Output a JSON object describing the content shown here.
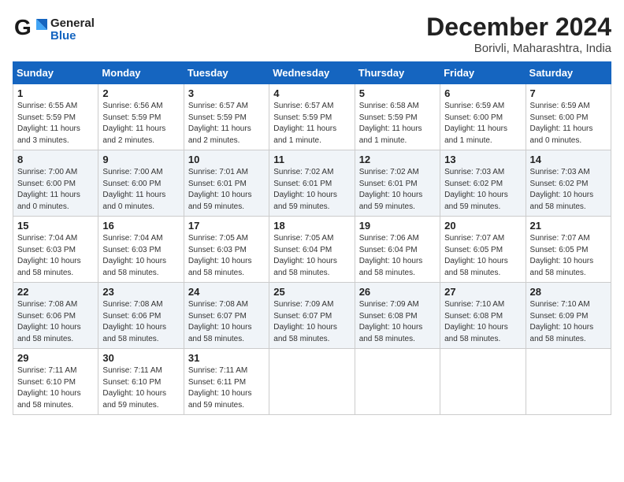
{
  "logo": {
    "general": "General",
    "blue": "Blue"
  },
  "title": {
    "month": "December 2024",
    "location": "Borivli, Maharashtra, India"
  },
  "headers": [
    "Sunday",
    "Monday",
    "Tuesday",
    "Wednesday",
    "Thursday",
    "Friday",
    "Saturday"
  ],
  "weeks": [
    [
      {
        "day": "1",
        "info": "Sunrise: 6:55 AM\nSunset: 5:59 PM\nDaylight: 11 hours and 3 minutes."
      },
      {
        "day": "2",
        "info": "Sunrise: 6:56 AM\nSunset: 5:59 PM\nDaylight: 11 hours and 2 minutes."
      },
      {
        "day": "3",
        "info": "Sunrise: 6:57 AM\nSunset: 5:59 PM\nDaylight: 11 hours and 2 minutes."
      },
      {
        "day": "4",
        "info": "Sunrise: 6:57 AM\nSunset: 5:59 PM\nDaylight: 11 hours and 1 minute."
      },
      {
        "day": "5",
        "info": "Sunrise: 6:58 AM\nSunset: 5:59 PM\nDaylight: 11 hours and 1 minute."
      },
      {
        "day": "6",
        "info": "Sunrise: 6:59 AM\nSunset: 6:00 PM\nDaylight: 11 hours and 1 minute."
      },
      {
        "day": "7",
        "info": "Sunrise: 6:59 AM\nSunset: 6:00 PM\nDaylight: 11 hours and 0 minutes."
      }
    ],
    [
      {
        "day": "8",
        "info": "Sunrise: 7:00 AM\nSunset: 6:00 PM\nDaylight: 11 hours and 0 minutes."
      },
      {
        "day": "9",
        "info": "Sunrise: 7:00 AM\nSunset: 6:00 PM\nDaylight: 11 hours and 0 minutes."
      },
      {
        "day": "10",
        "info": "Sunrise: 7:01 AM\nSunset: 6:01 PM\nDaylight: 10 hours and 59 minutes."
      },
      {
        "day": "11",
        "info": "Sunrise: 7:02 AM\nSunset: 6:01 PM\nDaylight: 10 hours and 59 minutes."
      },
      {
        "day": "12",
        "info": "Sunrise: 7:02 AM\nSunset: 6:01 PM\nDaylight: 10 hours and 59 minutes."
      },
      {
        "day": "13",
        "info": "Sunrise: 7:03 AM\nSunset: 6:02 PM\nDaylight: 10 hours and 59 minutes."
      },
      {
        "day": "14",
        "info": "Sunrise: 7:03 AM\nSunset: 6:02 PM\nDaylight: 10 hours and 58 minutes."
      }
    ],
    [
      {
        "day": "15",
        "info": "Sunrise: 7:04 AM\nSunset: 6:03 PM\nDaylight: 10 hours and 58 minutes."
      },
      {
        "day": "16",
        "info": "Sunrise: 7:04 AM\nSunset: 6:03 PM\nDaylight: 10 hours and 58 minutes."
      },
      {
        "day": "17",
        "info": "Sunrise: 7:05 AM\nSunset: 6:03 PM\nDaylight: 10 hours and 58 minutes."
      },
      {
        "day": "18",
        "info": "Sunrise: 7:05 AM\nSunset: 6:04 PM\nDaylight: 10 hours and 58 minutes."
      },
      {
        "day": "19",
        "info": "Sunrise: 7:06 AM\nSunset: 6:04 PM\nDaylight: 10 hours and 58 minutes."
      },
      {
        "day": "20",
        "info": "Sunrise: 7:07 AM\nSunset: 6:05 PM\nDaylight: 10 hours and 58 minutes."
      },
      {
        "day": "21",
        "info": "Sunrise: 7:07 AM\nSunset: 6:05 PM\nDaylight: 10 hours and 58 minutes."
      }
    ],
    [
      {
        "day": "22",
        "info": "Sunrise: 7:08 AM\nSunset: 6:06 PM\nDaylight: 10 hours and 58 minutes."
      },
      {
        "day": "23",
        "info": "Sunrise: 7:08 AM\nSunset: 6:06 PM\nDaylight: 10 hours and 58 minutes."
      },
      {
        "day": "24",
        "info": "Sunrise: 7:08 AM\nSunset: 6:07 PM\nDaylight: 10 hours and 58 minutes."
      },
      {
        "day": "25",
        "info": "Sunrise: 7:09 AM\nSunset: 6:07 PM\nDaylight: 10 hours and 58 minutes."
      },
      {
        "day": "26",
        "info": "Sunrise: 7:09 AM\nSunset: 6:08 PM\nDaylight: 10 hours and 58 minutes."
      },
      {
        "day": "27",
        "info": "Sunrise: 7:10 AM\nSunset: 6:08 PM\nDaylight: 10 hours and 58 minutes."
      },
      {
        "day": "28",
        "info": "Sunrise: 7:10 AM\nSunset: 6:09 PM\nDaylight: 10 hours and 58 minutes."
      }
    ],
    [
      {
        "day": "29",
        "info": "Sunrise: 7:11 AM\nSunset: 6:10 PM\nDaylight: 10 hours and 58 minutes."
      },
      {
        "day": "30",
        "info": "Sunrise: 7:11 AM\nSunset: 6:10 PM\nDaylight: 10 hours and 59 minutes."
      },
      {
        "day": "31",
        "info": "Sunrise: 7:11 AM\nSunset: 6:11 PM\nDaylight: 10 hours and 59 minutes."
      },
      null,
      null,
      null,
      null
    ]
  ]
}
